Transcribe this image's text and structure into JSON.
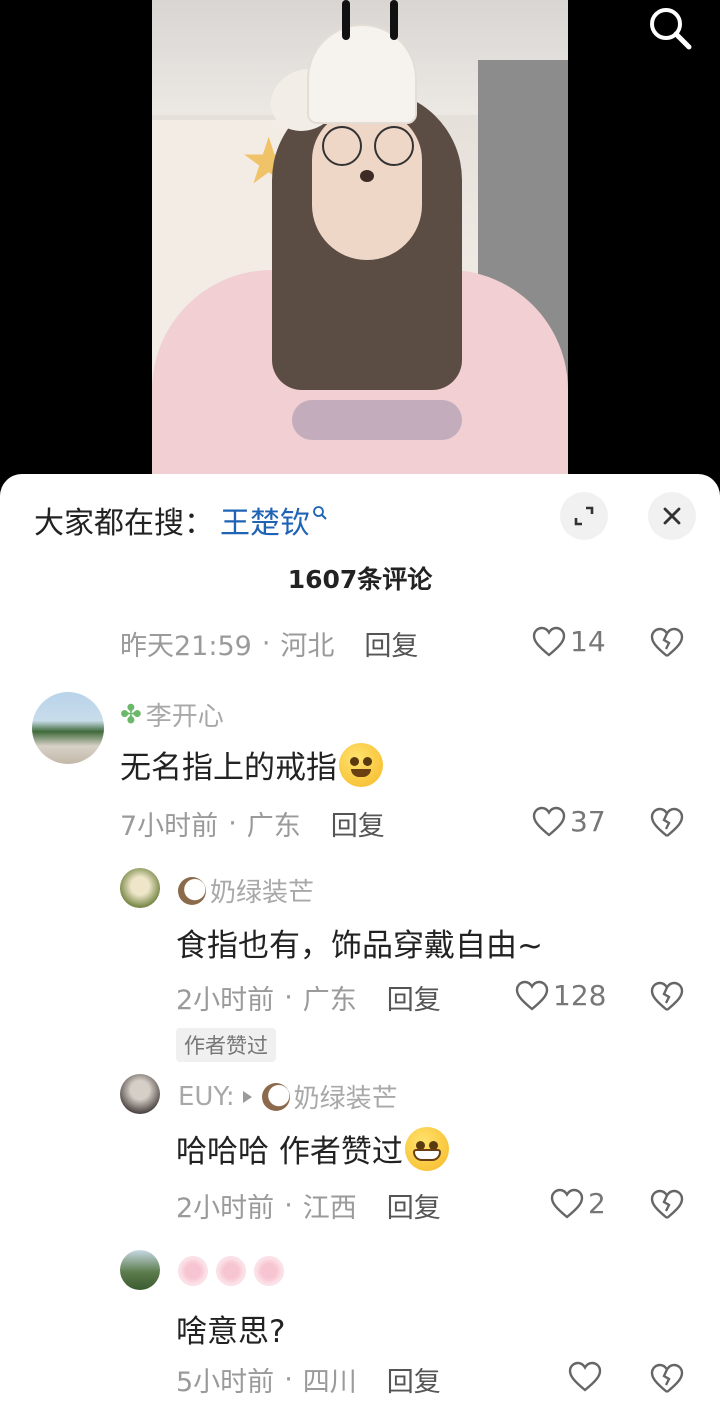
{
  "header": {
    "hot_search_prefix": "大家都在搜：",
    "hot_search_keyword": "王楚钦"
  },
  "comment_count": "1607条评论",
  "comments": [
    {
      "time": "昨天21:59",
      "location": "河北",
      "reply": "回复",
      "likes": "14"
    },
    {
      "username": "李开心",
      "text": "无名指上的戒指",
      "time": "7小时前",
      "location": "广东",
      "reply": "回复",
      "likes": "37"
    }
  ],
  "replies": [
    {
      "username": "奶绿装芒",
      "text": "食指也有，饰品穿戴自由~",
      "time": "2小时前",
      "location": "广东",
      "reply": "回复",
      "likes": "128",
      "badge": "作者赞过"
    },
    {
      "username": "EUY:",
      "reply_to": "奶绿装芒",
      "text": "哈哈哈 作者赞过",
      "time": "2小时前",
      "location": "江西",
      "reply": "回复",
      "likes": "2"
    },
    {
      "text": "啥意思?",
      "time": "5小时前",
      "location": "四川",
      "reply": "回复",
      "likes": ""
    }
  ],
  "separator": "·",
  "icons": {
    "search": "search-icon",
    "expand": "expand-icon",
    "close": "close-icon",
    "like": "heart-icon",
    "dislike": "broken-heart-icon"
  },
  "colors": {
    "keyword": "#1f63b5",
    "meta": "#9a9a9a",
    "text": "#222222"
  }
}
